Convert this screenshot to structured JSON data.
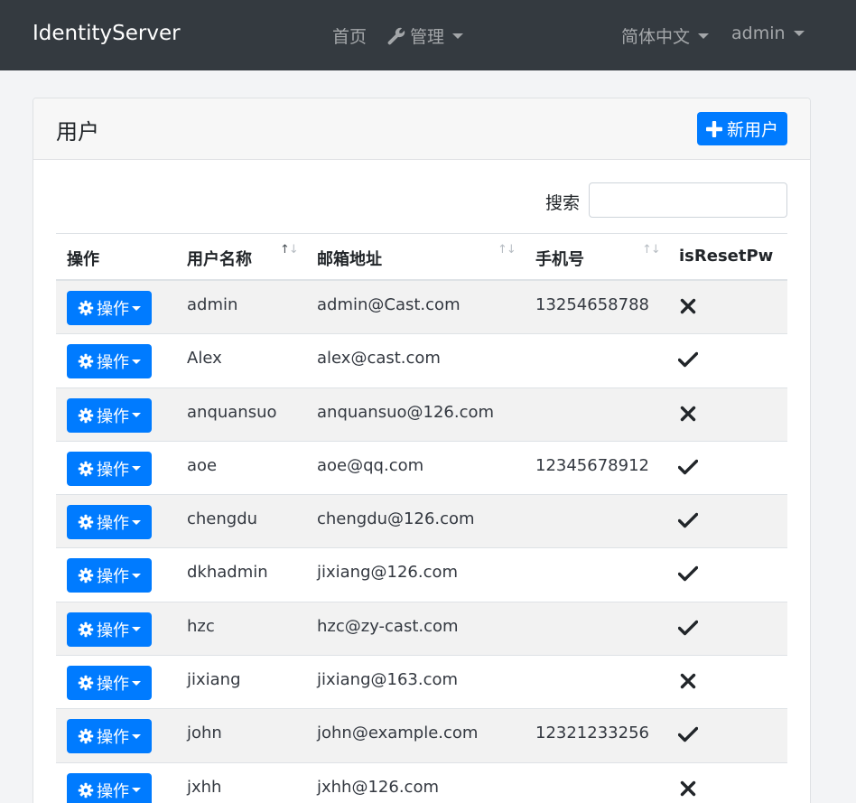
{
  "navbar": {
    "brand": "IdentityServer",
    "home": "首页",
    "manage": "管理",
    "language": "简体中文",
    "user": "admin"
  },
  "card": {
    "title": "用户",
    "new_user_label": "新用户"
  },
  "search": {
    "label": "搜索",
    "value": ""
  },
  "table": {
    "columns": {
      "actions": "操作",
      "username": "用户名称",
      "email": "邮箱地址",
      "phone": "手机号",
      "reset": "isResetPw"
    },
    "sort_arrows": "↑↓",
    "action_label": "操作",
    "rows": [
      {
        "username": "admin",
        "email": "admin@Cast.com",
        "phone": "13254658788",
        "reset": false
      },
      {
        "username": "Alex",
        "email": "alex@cast.com",
        "phone": "",
        "reset": true
      },
      {
        "username": "anquansuo",
        "email": "anquansuo@126.com",
        "phone": "",
        "reset": false
      },
      {
        "username": "aoe",
        "email": "aoe@qq.com",
        "phone": "12345678912",
        "reset": true
      },
      {
        "username": "chengdu",
        "email": "chengdu@126.com",
        "phone": "",
        "reset": true
      },
      {
        "username": "dkhadmin",
        "email": "jixiang@126.com",
        "phone": "",
        "reset": true
      },
      {
        "username": "hzc",
        "email": "hzc@zy-cast.com",
        "phone": "",
        "reset": true
      },
      {
        "username": "jixiang",
        "email": "jixiang@163.com",
        "phone": "",
        "reset": false
      },
      {
        "username": "john",
        "email": "john@example.com",
        "phone": "12321233256",
        "reset": true
      },
      {
        "username": "jxhh",
        "email": "jxhh@126.com",
        "phone": "",
        "reset": false
      }
    ]
  },
  "colors": {
    "navbar": "#343a40",
    "primary": "#007bff",
    "stripe": "#f2f2f2"
  },
  "icons": [
    "wrench-icon",
    "plus-icon",
    "gear-icon",
    "check-icon",
    "times-icon",
    "caret-down-icon",
    "sort-icon"
  ]
}
